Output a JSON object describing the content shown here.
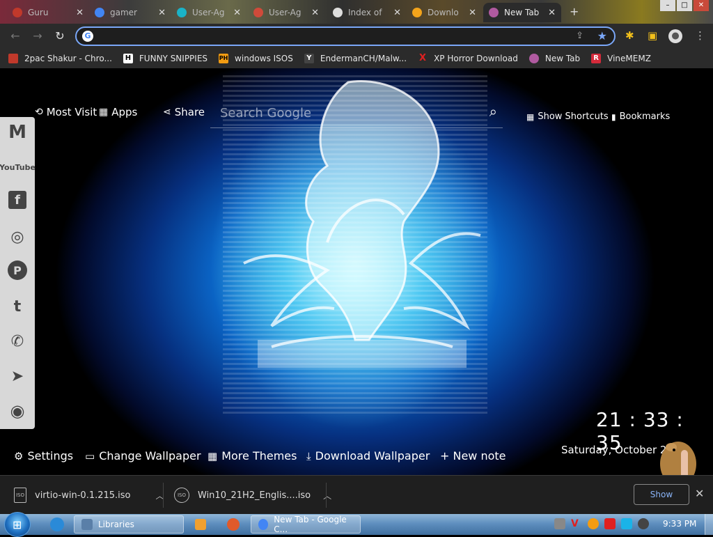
{
  "browser": {
    "tabs": [
      {
        "title": "Guru",
        "favicon_color": "#c0392b",
        "active": false
      },
      {
        "title": "gamer",
        "favicon_color": "#4285f4",
        "active": false
      },
      {
        "title": "User-Ag",
        "favicon_color": "#1ab3c8",
        "active": false
      },
      {
        "title": "User-Ag",
        "favicon_color": "#d04a3a",
        "active": false
      },
      {
        "title": "Index of",
        "favicon_color": "#dddddd",
        "active": false
      },
      {
        "title": "Downlo",
        "favicon_color": "#f3a41b",
        "active": false
      },
      {
        "title": "New Tab",
        "favicon_color": "#b05aa0",
        "active": true
      }
    ],
    "omnibox": {
      "value": "",
      "placeholder": ""
    },
    "bookmarks": [
      {
        "label": "2pac Shakur - Chro...",
        "icon": "app-icon",
        "icon_text": "",
        "color": "#c0392b"
      },
      {
        "label": "FUNNY SNIPPIES",
        "icon": "h-icon",
        "icon_text": "H",
        "color": "#ffffff"
      },
      {
        "label": "windows ISOS",
        "icon": "ph-icon",
        "icon_text": "PH",
        "color": "#f39c12"
      },
      {
        "label": "EndermanCH/Malw...",
        "icon": "yp-icon",
        "icon_text": "Y",
        "color": "#444444"
      },
      {
        "label": "XP Horror Download",
        "icon": "x-icon",
        "icon_text": "X",
        "color": "#e02020"
      },
      {
        "label": "New Tab",
        "icon": "unicorn-icon",
        "icon_text": "",
        "color": "#b05aa0"
      },
      {
        "label": "VineMEMZ",
        "icon": "r-icon",
        "icon_text": "R",
        "color": "#d42a3a"
      }
    ]
  },
  "newtab": {
    "top_left": {
      "most_visited": "Most Visit",
      "apps": "Apps",
      "share": "Share"
    },
    "search": {
      "placeholder": "Search Google"
    },
    "top_right": {
      "shortcuts": "Show Shortcuts",
      "bookmarks": "Bookmarks"
    },
    "social": [
      "gmail-icon",
      "youtube-icon",
      "facebook-icon",
      "instagram-icon",
      "pinterest-icon",
      "twitter-icon",
      "whatsapp-icon",
      "telegram-icon",
      "reddit-icon"
    ],
    "social_text": {
      "gmail": "M",
      "youtube": "YouTube",
      "facebook": "f",
      "instagram": "◎",
      "pinterest": "P",
      "twitter": "t",
      "whatsapp": "✆",
      "telegram": "➤",
      "reddit": "◉"
    },
    "clock": "21 : 33 : 35",
    "date": "Saturday, October 2",
    "bottom": {
      "settings": "Settings",
      "change_wallpaper": "Change Wallpaper",
      "more_themes": "More Themes",
      "download_wallpaper": "Download Wallpaper",
      "new_note": "+ New note"
    }
  },
  "downloads": {
    "items": [
      {
        "name": "virtio-win-0.1.215.iso"
      },
      {
        "name": "Win10_21H2_Englis....iso"
      }
    ],
    "show_all": "Show",
    "file_icon_text": "ISO"
  },
  "taskbar": {
    "tasks": [
      {
        "label": "Libraries",
        "icon_color": "#5a7fa8"
      },
      {
        "label": "New Tab - Google C...",
        "icon_color": "#4285f4"
      }
    ],
    "time": "9:33 PM"
  }
}
